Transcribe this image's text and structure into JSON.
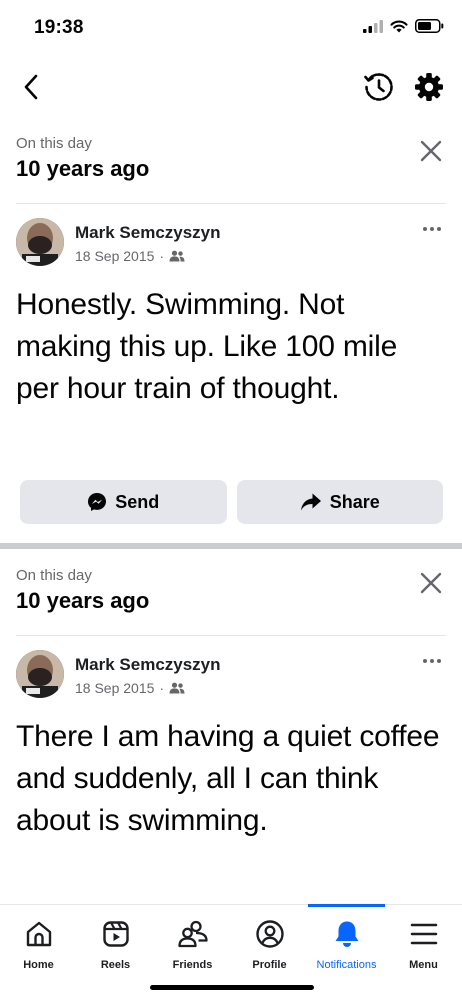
{
  "status_bar": {
    "time": "19:38",
    "icons": [
      "signal-icon",
      "wifi-icon",
      "battery-icon"
    ]
  },
  "topbar": {
    "icons": [
      "back-icon",
      "history-icon",
      "gear-icon"
    ]
  },
  "memories": [
    {
      "label": "On this day",
      "heading": "10 years ago",
      "author": "Mark Semczyszyn",
      "date": "18 Sep 2015",
      "separator": "·",
      "audience_icon": "friends-icon",
      "text": "Honestly. Swimming. Not making this up. Like 100 mile per hour train of thought.",
      "actions": [
        {
          "label": "Send",
          "icon": "messenger-icon"
        },
        {
          "label": "Share",
          "icon": "share-icon"
        }
      ]
    },
    {
      "label": "On this day",
      "heading": "10 years ago",
      "author": "Mark Semczyszyn",
      "date": "18 Sep 2015",
      "separator": "·",
      "audience_icon": "friends-icon",
      "text": "There I am having a quiet coffee and suddenly, all I can think about is swimming."
    }
  ],
  "bottom_nav": {
    "items": [
      {
        "label": "Home",
        "icon": "home-icon"
      },
      {
        "label": "Reels",
        "icon": "reels-icon"
      },
      {
        "label": "Friends",
        "icon": "friends-icon"
      },
      {
        "label": "Profile",
        "icon": "profile-icon"
      },
      {
        "label": "Notifications",
        "icon": "bell-icon",
        "active": true
      },
      {
        "label": "Menu",
        "icon": "menu-icon"
      }
    ]
  },
  "colors": {
    "accent": "#0866ff",
    "text": "#050505",
    "secondary_text": "#65676b",
    "button_bg": "#e4e6eb",
    "separator": "#c9ccd1"
  }
}
